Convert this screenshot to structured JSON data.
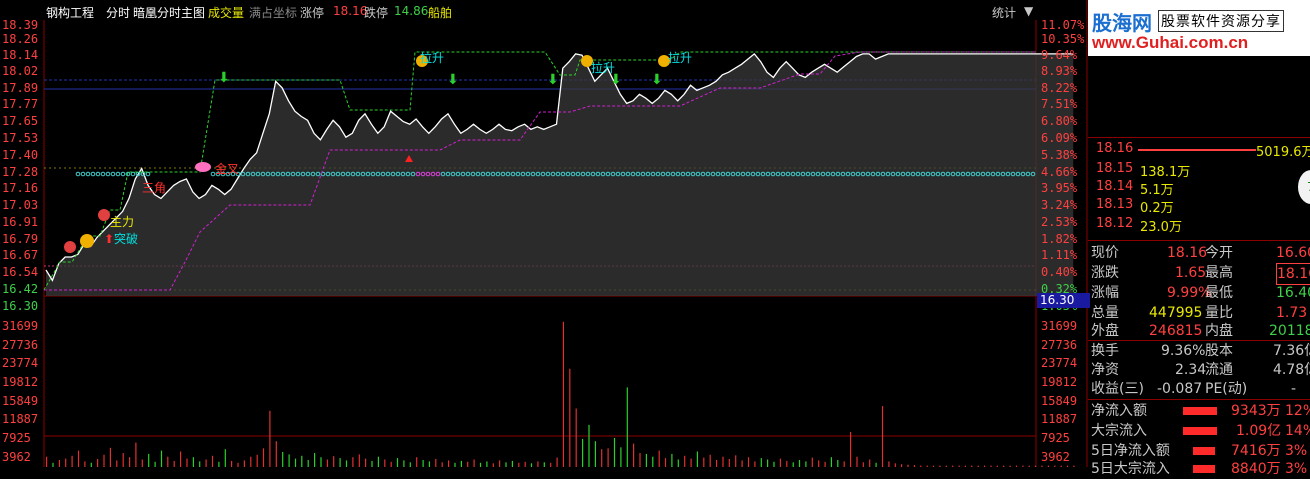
{
  "header": {
    "stock_name": "钢构工程",
    "view_mode": "分时",
    "indicator_name": "暗凰分时主图",
    "volume_label": "成交量",
    "coord_mode": "满占坐标",
    "limit_up_label": "涨停",
    "limit_up_value": "18.16",
    "limit_down_label": "跌停",
    "limit_down_value": "14.86",
    "sector": "船舶",
    "stats_button": "统计"
  },
  "watermark": {
    "logo_text": "股海网",
    "slogan": "股票软件资源分享",
    "url": "www.Guhai.com.cn"
  },
  "price_axis": {
    "left_ticks": [
      "18.39",
      "18.26",
      "18.14",
      "18.02",
      "17.89",
      "17.77",
      "17.65",
      "17.53",
      "17.40",
      "17.28",
      "17.16",
      "17.03",
      "16.91",
      "16.79",
      "16.67",
      "16.54",
      "16.42",
      "16.30"
    ],
    "right_ticks": [
      "11.07%",
      "10.35%",
      "9.64%",
      "8.93%",
      "8.22%",
      "7.51%",
      "6.80%",
      "6.09%",
      "5.38%",
      "4.66%",
      "3.95%",
      "3.24%",
      "2.53%",
      "1.82%",
      "1.11%",
      "0.40%",
      "0.32%",
      "1.03%"
    ],
    "cursor_price": "16.30"
  },
  "volume_axis": {
    "ticks": [
      "31699",
      "27736",
      "23774",
      "19812",
      "15849",
      "11887",
      "7925",
      "3962"
    ]
  },
  "annotations": {
    "zhuli": "主力",
    "tupo": "突破",
    "sanjiao": "三角",
    "jinji": "金叉",
    "lashenA": "拉升",
    "lashenB": "拉升",
    "lashenC": "拉升"
  },
  "order_book": [
    {
      "price": "18.16",
      "vol": "5019.6万",
      "bar": 1.0
    },
    {
      "price": "18.15",
      "vol": "138.1万",
      "bar": 0
    },
    {
      "price": "18.14",
      "vol": "5.1万",
      "bar": 0
    },
    {
      "price": "18.13",
      "vol": "0.2万",
      "bar": 0
    },
    {
      "price": "18.12",
      "vol": "23.0万",
      "bar": 0
    }
  ],
  "quote": [
    {
      "l1": "现价",
      "v1": "18.16",
      "c1": "#ff4040",
      "l2": "今开",
      "v2": "16.60",
      "c2": "#ff4040"
    },
    {
      "l1": "涨跌",
      "v1": "1.65",
      "c1": "#ff4040",
      "l2": "最高",
      "v2": "18.16",
      "c2": "#ff4040"
    },
    {
      "l1": "涨幅",
      "v1": "9.99%",
      "c1": "#ff4040",
      "l2": "最低",
      "v2": "16.40",
      "c2": "#3fd04a"
    },
    {
      "l1": "总量",
      "v1": "447995",
      "c1": "#e8e800",
      "l2": "量比",
      "v2": "1.73",
      "c2": "#ff4040"
    },
    {
      "l1": "外盘",
      "v1": "246815",
      "c1": "#ff4040",
      "l2": "内盘",
      "v2": "201180",
      "c2": "#3fd04a"
    }
  ],
  "fundamentals": [
    {
      "l1": "换手",
      "v1": "9.36%",
      "l2": "股本",
      "v2": "7.36亿"
    },
    {
      "l1": "净资",
      "v1": "2.34",
      "l2": "流通",
      "v2": "4.78亿"
    },
    {
      "l1": "收益(三)",
      "v1": "-0.087",
      "l2": "PE(动)",
      "v2": "-"
    }
  ],
  "fund_flow": [
    {
      "label": "净流入额",
      "value": "9343万",
      "pct": "12%"
    },
    {
      "label": "大宗流入",
      "value": "1.09亿",
      "pct": "14%"
    },
    {
      "label": "5日净流入额",
      "value": "7416万",
      "pct": "3%"
    },
    {
      "label": "5日大宗流入",
      "value": "8840万",
      "pct": "3%"
    }
  ],
  "chart_data": {
    "type": "line",
    "price_series": [
      16.5,
      16.42,
      16.55,
      16.6,
      16.6,
      16.62,
      16.7,
      16.68,
      16.75,
      16.8,
      16.85,
      16.9,
      16.95,
      17.05,
      17.2,
      17.28,
      17.15,
      17.08,
      17.05,
      17.1,
      17.15,
      17.18,
      17.2,
      17.1,
      17.05,
      17.08,
      17.15,
      17.12,
      17.08,
      17.12,
      17.2,
      17.28,
      17.35,
      17.4,
      17.55,
      17.7,
      17.95,
      17.9,
      17.8,
      17.72,
      17.68,
      17.65,
      17.55,
      17.5,
      17.58,
      17.65,
      17.6,
      17.52,
      17.55,
      17.65,
      17.7,
      17.62,
      17.55,
      17.6,
      17.72,
      17.68,
      17.64,
      17.62,
      17.66,
      17.6,
      17.55,
      17.6,
      17.66,
      17.7,
      17.62,
      17.55,
      17.58,
      17.62,
      17.58,
      17.55,
      17.58,
      17.62,
      17.58,
      17.57,
      17.6,
      17.62,
      17.58,
      17.6,
      17.58,
      17.6,
      17.62,
      18.05,
      18.1,
      18.16,
      18.15,
      18.05,
      17.95,
      18.0,
      18.05,
      17.95,
      17.85,
      17.78,
      17.8,
      17.85,
      17.82,
      17.78,
      17.82,
      17.88,
      17.85,
      17.8,
      17.85,
      17.92,
      17.88,
      17.9,
      17.92,
      17.95,
      18.0,
      18.02,
      18.05,
      18.08,
      18.12,
      18.16,
      18.1,
      18.02,
      17.98,
      18.05,
      18.1,
      18.05,
      18.0,
      17.98,
      18.02,
      18.05,
      18.08,
      18.05,
      18.02,
      18.06,
      18.1,
      18.14,
      18.16,
      18.16,
      18.12,
      18.14,
      18.16,
      18.16,
      18.16,
      18.16,
      18.16,
      18.16,
      18.16,
      18.16,
      18.16,
      18.16,
      18.16,
      18.16,
      18.16,
      18.16,
      18.16,
      18.16,
      18.16,
      18.16,
      18.16,
      18.16,
      18.16,
      18.16,
      18.16,
      18.16,
      18.16,
      18.16,
      18.16,
      18.16,
      18.16,
      18.16
    ],
    "volume_series": [
      2200,
      900,
      1500,
      1800,
      2400,
      3500,
      1200,
      900,
      1700,
      2600,
      4100,
      1400,
      3000,
      2100,
      5200,
      1600,
      2800,
      1100,
      3500,
      2200,
      1300,
      3300,
      1800,
      2100,
      1200,
      1600,
      2400,
      1100,
      3800,
      1300,
      900,
      1400,
      2200,
      2600,
      4000,
      12000,
      5500,
      3200,
      2700,
      1800,
      2400,
      1500,
      3000,
      2100,
      1600,
      2300,
      1900,
      1400,
      2100,
      2700,
      1800,
      1300,
      2200,
      1600,
      1100,
      1900,
      1400,
      1000,
      2100,
      1500,
      1200,
      1700,
      1000,
      1400,
      900,
      1300,
      1100,
      1600,
      900,
      1200,
      800,
      1400,
      1000,
      1300,
      900,
      1100,
      800,
      1200,
      1000,
      900,
      2000,
      31000,
      21000,
      12500,
      6000,
      9000,
      5500,
      3800,
      4000,
      6200,
      4200,
      17000,
      5000,
      3000,
      2800,
      2200,
      3500,
      1900,
      2800,
      1600,
      2400,
      1800,
      3300,
      2000,
      2600,
      1500,
      2200,
      1700,
      2500,
      1400,
      2100,
      1200,
      1900,
      1600,
      1100,
      1800,
      1300,
      1000,
      1500,
      1200,
      2000,
      1400,
      1100,
      2100,
      1500,
      1200,
      7500,
      2200,
      1000,
      1600,
      900,
      13000,
      1200,
      800,
      600,
      500,
      400,
      300,
      300,
      300,
      300,
      300,
      300,
      300,
      300,
      300,
      300,
      300,
      300,
      300,
      300,
      300,
      300,
      300,
      300,
      300,
      300,
      300,
      300,
      300,
      300,
      300
    ],
    "ylim": [
      16.3,
      18.39
    ],
    "volume_ylim": [
      0,
      35661
    ],
    "limit_up_line": 18.16,
    "prev_close": 16.51
  }
}
